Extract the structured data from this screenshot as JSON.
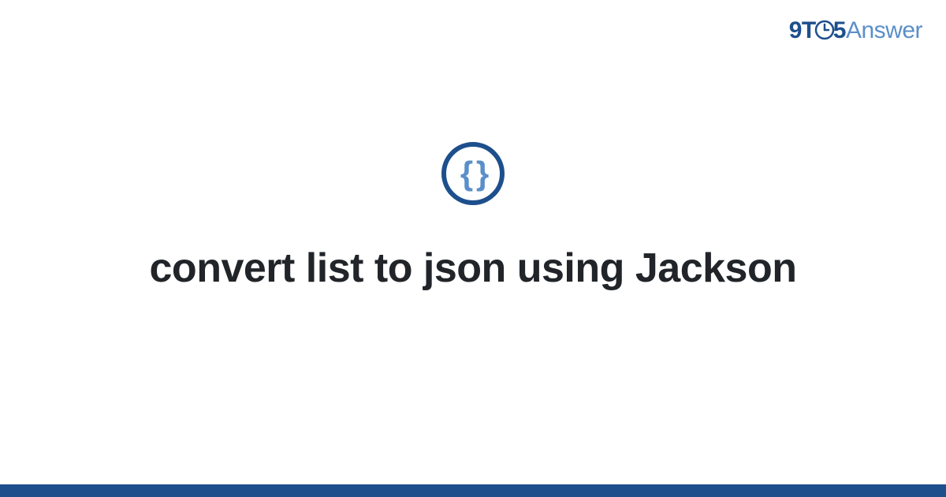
{
  "logo": {
    "part1": "9T",
    "part2": "5",
    "part3": "Answer"
  },
  "icon": {
    "name": "braces-icon",
    "glyph": "{ }"
  },
  "title": "convert list to json using Jackson",
  "colors": {
    "primary": "#1d4f8c",
    "secondary": "#5a8fc9",
    "text": "#212529"
  }
}
